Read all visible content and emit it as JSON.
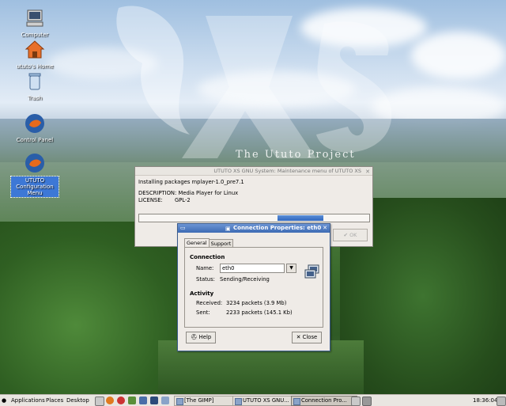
{
  "desktop": {
    "icons": [
      {
        "label": "Computer"
      },
      {
        "label": "ututo's Home"
      },
      {
        "label": "Trash"
      },
      {
        "label": "Control Panel"
      },
      {
        "label": "UTUTO Configuration Menu"
      }
    ],
    "watermark_text": "The Ututo Project"
  },
  "maintenance_window": {
    "title": "UTUTO XS GNU System: Maintenance menu of UTUTO XS",
    "line1": "Installing packages mplayer-1.0_pre7.1",
    "line2": "DESCRIPTION:  Media Player for Linux",
    "line3": "LICENSE:       GPL-2",
    "progress": 0.2,
    "ok_label": "OK"
  },
  "connection_dialog": {
    "title": "Connection Properties: eth0",
    "tabs": [
      {
        "label": "General",
        "active": true
      },
      {
        "label": "Support",
        "active": false
      }
    ],
    "connection_section": "Connection",
    "name_label": "Name:",
    "name_value": "eth0",
    "status_label": "Status:",
    "status_value": "Sending/Receiving",
    "activity_section": "Activity",
    "received_label": "Received:",
    "received_value": "3234 packets (3.9 Mb)",
    "sent_label": "Sent:",
    "sent_value": "2233 packets (145.1 Kb)",
    "help_label": "Help",
    "close_label": "Close"
  },
  "panel": {
    "menus": [
      "Applications",
      "Places",
      "Desktop"
    ],
    "tasks": [
      {
        "label": "[The GIMP]",
        "active": false
      },
      {
        "label": "UTUTO XS GNU...",
        "active": false
      },
      {
        "label": "Connection Pro...",
        "active": true
      }
    ],
    "clock": "18:36:04"
  },
  "colors": {
    "titlebar_active": "#3d6bb3",
    "progress_fill": "#2f67c0",
    "selection": "#3d78d6"
  }
}
